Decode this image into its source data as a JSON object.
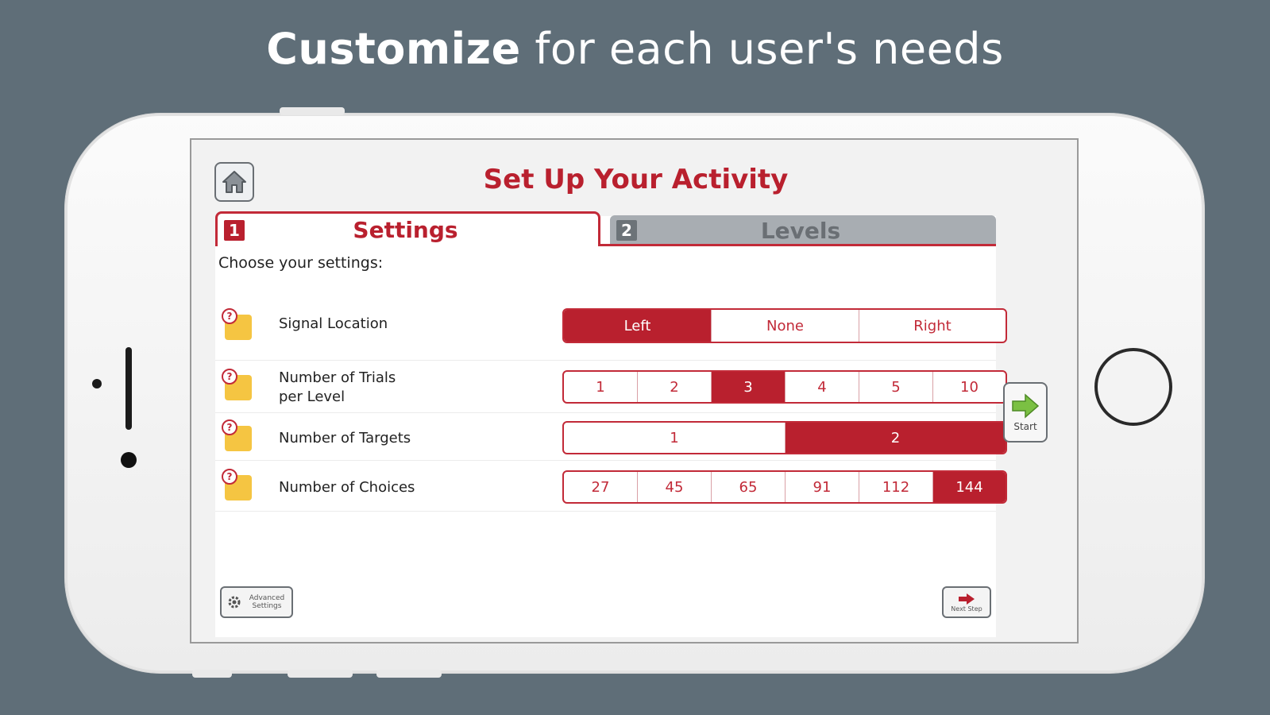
{
  "headline": {
    "bold": "Customize",
    "rest": " for each user's needs"
  },
  "screen": {
    "title": "Set Up Your Activity",
    "tabs": [
      {
        "num": "1",
        "label": "Settings",
        "active": true
      },
      {
        "num": "2",
        "label": "Levels",
        "active": false
      }
    ],
    "instruction": "Choose your settings:",
    "rows": [
      {
        "label_line1": "Signal Location",
        "label_line2": "",
        "options": [
          "Left",
          "None",
          "Right"
        ],
        "selected": "Left"
      },
      {
        "label_line1": "Number of Trials",
        "label_line2": "per Level",
        "options": [
          "1",
          "2",
          "3",
          "4",
          "5",
          "10"
        ],
        "selected": "3"
      },
      {
        "label_line1": "Number of Targets",
        "label_line2": "",
        "options": [
          "1",
          "2"
        ],
        "selected": "2"
      },
      {
        "label_line1": "Number of Choices",
        "label_line2": "",
        "options": [
          "27",
          "45",
          "65",
          "91",
          "112",
          "144"
        ],
        "selected": "144"
      }
    ],
    "help_glyph": "?",
    "start_label": "Start",
    "advanced_label_1": "Advanced",
    "advanced_label_2": "Settings",
    "next_label": "Next Step"
  },
  "colors": {
    "accent": "#b9202e",
    "background": "#5f6e78",
    "start_arrow": "#7bc043"
  },
  "icons": [
    "home-icon",
    "help-icon",
    "start-arrow-icon",
    "gear-icon",
    "next-arrow-icon"
  ]
}
